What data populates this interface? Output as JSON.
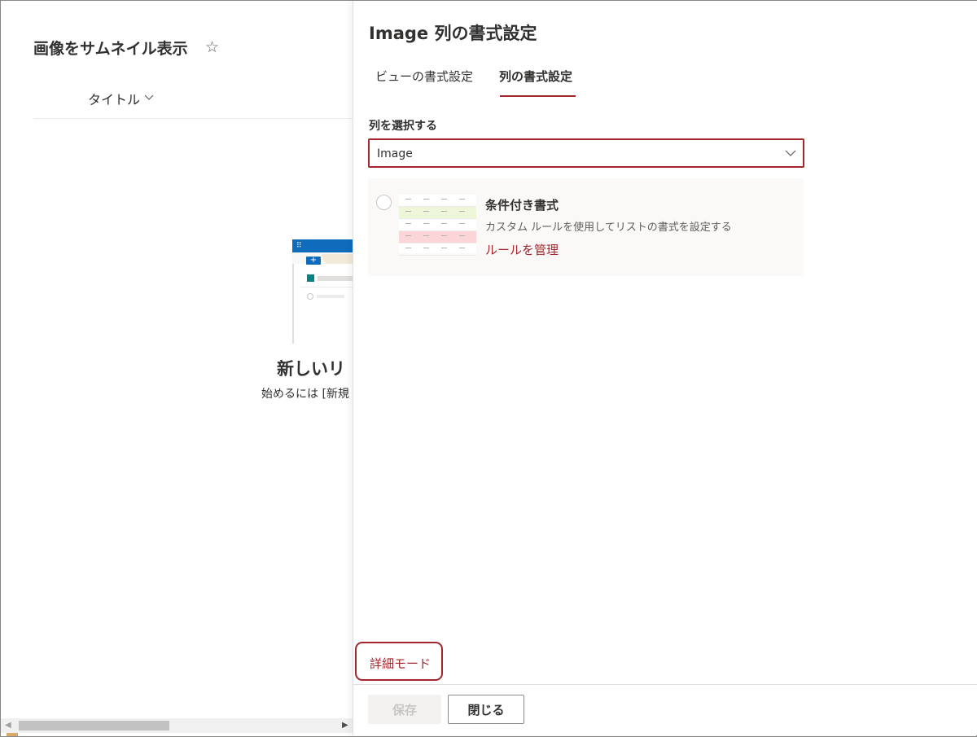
{
  "list_page": {
    "title": "画像をサムネイル表示",
    "favorite_icon": "star-outline-icon",
    "column_header": "タイトル",
    "empty_state": {
      "title": "新しいリ",
      "description": "始めるには [新規"
    }
  },
  "panel": {
    "title": "Image 列の書式設定",
    "tabs": [
      {
        "label": "ビューの書式設定",
        "selected": false
      },
      {
        "label": "列の書式設定",
        "selected": true
      }
    ],
    "column_select": {
      "label": "列を選択する",
      "value": "Image"
    },
    "conditional_format": {
      "title": "条件付き書式",
      "description": "カスタム ルールを使用してリストの書式を設定する",
      "link": "ルールを管理"
    },
    "advanced_mode": "詳細モード",
    "buttons": {
      "save": "保存",
      "close": "閉じる"
    }
  },
  "colors": {
    "accent": "#a4262c",
    "brand_blue": "#0f6cbd",
    "card_bg": "#faf9f8"
  }
}
